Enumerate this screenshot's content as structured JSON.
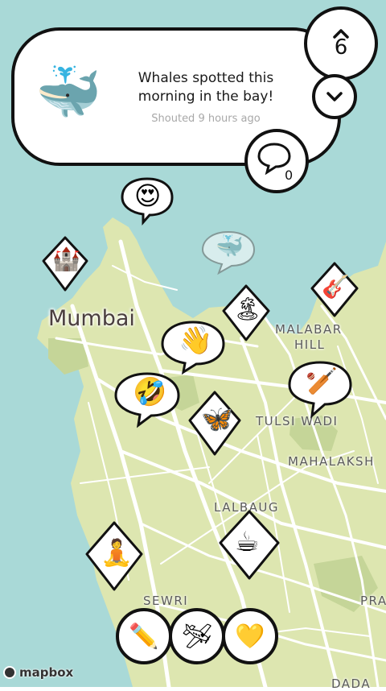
{
  "colors": {
    "water": "#a9d9d7",
    "land": "#dde6b0",
    "park": "#c5d598",
    "road": "#ffffff",
    "outline": "#111111"
  },
  "shout": {
    "emoji": "🐳",
    "icon": "whale-icon",
    "title": "Whales spotted this morning in the bay!",
    "subtitle": "Shouted 9 hours ago",
    "votes": "6",
    "comments": "0"
  },
  "map": {
    "city": "Mumbai",
    "places": [
      "MALABAR",
      "HILL",
      "TULSI WADI",
      "MAHALAKSH",
      "LALBAUG",
      "SEWRI",
      "PRA",
      "DADA"
    ]
  },
  "pins": [
    {
      "emoji": "😍",
      "name": "heart-eyes-icon"
    },
    {
      "emoji": "🐳",
      "name": "whale-icon"
    },
    {
      "emoji": "🏰",
      "name": "castle-icon"
    },
    {
      "emoji": "🎸",
      "name": "guitar-icon"
    },
    {
      "emoji": "🏝",
      "name": "island-icon"
    },
    {
      "emoji": "👋",
      "name": "waving-hand-icon"
    },
    {
      "emoji": "🤣",
      "name": "laughing-icon"
    },
    {
      "emoji": "🏏",
      "name": "cricket-icon"
    },
    {
      "emoji": "🦋",
      "name": "butterfly-icon"
    },
    {
      "emoji": "🧘",
      "name": "yoga-icon"
    },
    {
      "emoji": "☕",
      "name": "coffee-icon"
    }
  ],
  "toolbar": {
    "pencil": "✏️",
    "explore": "🛩",
    "favorite": "💛"
  },
  "attribution": "mapbox"
}
